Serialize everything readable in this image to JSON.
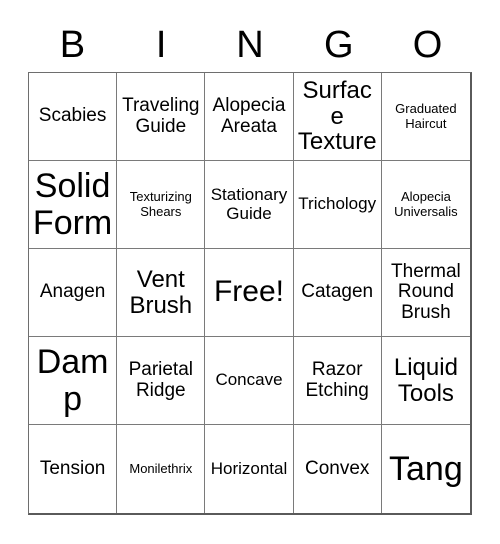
{
  "card": {
    "header_letters": [
      "B",
      "I",
      "N",
      "G",
      "O"
    ],
    "columns": 5,
    "rows": 5,
    "free_space_label": "Free!",
    "border_color": "#6e6e6e",
    "text_color": "#000000",
    "background_color": "#ffffff"
  },
  "cells": [
    {
      "text": "Scabies",
      "size": "md"
    },
    {
      "text": "Traveling\nGuide",
      "size": "md"
    },
    {
      "text": "Alopecia\nAreata",
      "size": "md"
    },
    {
      "text": "Surface\nTexture",
      "size": "lg"
    },
    {
      "text": "Graduated\nHaircut",
      "size": "xs"
    },
    {
      "text": "Solid\nForm",
      "size": "xxl"
    },
    {
      "text": "Texturizing\nShears",
      "size": "xs"
    },
    {
      "text": "Stationary\nGuide",
      "size": "sm"
    },
    {
      "text": "Trichology",
      "size": "sm"
    },
    {
      "text": "Alopecia\nUniversalis",
      "size": "xs"
    },
    {
      "text": "Anagen",
      "size": "md"
    },
    {
      "text": "Vent\nBrush",
      "size": "lg"
    },
    {
      "text": "Free!",
      "size": "xl"
    },
    {
      "text": "Catagen",
      "size": "md"
    },
    {
      "text": "Thermal\nRound\nBrush",
      "size": "md"
    },
    {
      "text": "Damp",
      "size": "xxl"
    },
    {
      "text": "Parietal\nRidge",
      "size": "md"
    },
    {
      "text": "Concave",
      "size": "sm"
    },
    {
      "text": "Razor\nEtching",
      "size": "md"
    },
    {
      "text": "Liquid\nTools",
      "size": "lg"
    },
    {
      "text": "Tension",
      "size": "md"
    },
    {
      "text": "Monilethrix",
      "size": "xs"
    },
    {
      "text": "Horizontal",
      "size": "sm"
    },
    {
      "text": "Convex",
      "size": "md"
    },
    {
      "text": "Tang",
      "size": "xxl"
    }
  ]
}
